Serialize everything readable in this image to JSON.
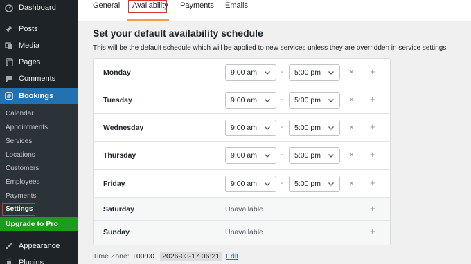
{
  "sidebar": {
    "dashboard": "Dashboard",
    "posts": "Posts",
    "media": "Media",
    "pages": "Pages",
    "comments": "Comments",
    "bookings": "Bookings",
    "submenu": [
      "Calendar",
      "Appointments",
      "Services",
      "Locations",
      "Customers",
      "Employees",
      "Payments",
      "Settings"
    ],
    "upgrade": "Upgrade to Pro",
    "appearance": "Appearance",
    "plugins": "Plugins"
  },
  "tabs": [
    "General",
    "Availability",
    "Payments",
    "Emails"
  ],
  "page": {
    "title": "Set your default availability schedule",
    "description": "This will be the default schedule which will be applied to new services unless they are overridden in service settings"
  },
  "schedule": [
    {
      "day": "Monday",
      "start": "9:00 am",
      "end": "5:00 pm"
    },
    {
      "day": "Tuesday",
      "start": "9:00 am",
      "end": "5:00 pm"
    },
    {
      "day": "Wednesday",
      "start": "9:00 am",
      "end": "5:00 pm"
    },
    {
      "day": "Thursday",
      "start": "9:00 am",
      "end": "5:00 pm"
    },
    {
      "day": "Friday",
      "start": "9:00 am",
      "end": "5:00 pm"
    },
    {
      "day": "Saturday",
      "status": "Unavailable"
    },
    {
      "day": "Sunday",
      "status": "Unavailable"
    }
  ],
  "separator": "-",
  "remove_glyph": "×",
  "add_glyph": "+",
  "timezone": {
    "label": "Time Zone:",
    "value": "+00:00",
    "datetime": "2026-03-17 06:21",
    "edit": "Edit"
  },
  "colors": {
    "sidebar_bg": "#1d2327",
    "accent": "#2271b1",
    "highlight_border": "#d63638",
    "upgrade_bg": "#1e9a1e",
    "tab_underline": "#f0a04b"
  }
}
